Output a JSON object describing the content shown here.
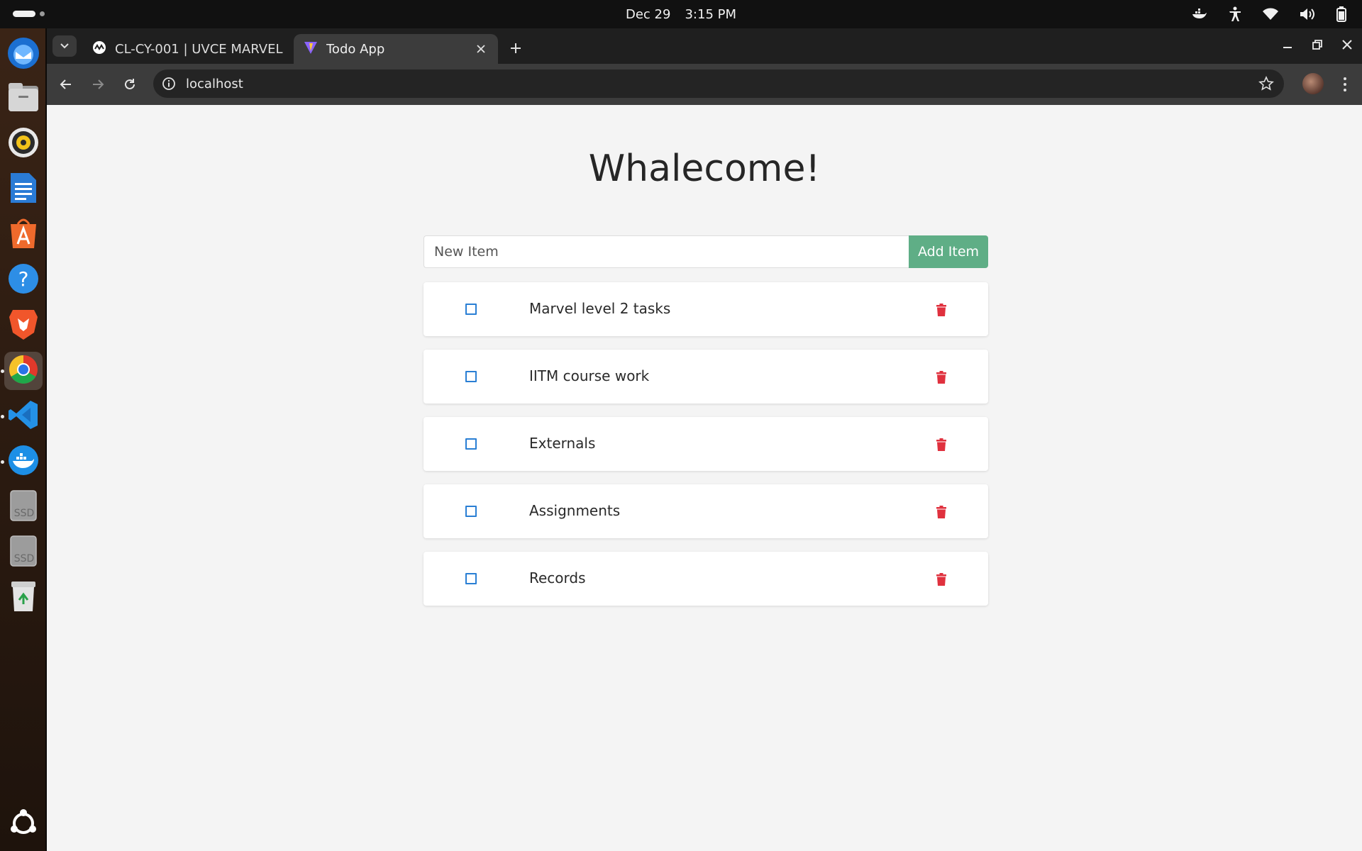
{
  "system_bar": {
    "date": "Dec 29",
    "time": "3:15 PM",
    "tray_icons": [
      "docker-icon",
      "accessibility-icon",
      "wifi-icon",
      "volume-icon",
      "battery-icon"
    ]
  },
  "dock": {
    "apps": [
      {
        "name": "Thunderbird",
        "icon": "thunderbird-icon"
      },
      {
        "name": "Files",
        "icon": "files-icon"
      },
      {
        "name": "Rhythmbox",
        "icon": "rhythmbox-icon"
      },
      {
        "name": "LibreOffice Writer",
        "icon": "writer-icon"
      },
      {
        "name": "App Center",
        "icon": "app-center-icon"
      },
      {
        "name": "Help",
        "icon": "help-icon"
      },
      {
        "name": "Brave",
        "icon": "brave-icon"
      },
      {
        "name": "Chrome",
        "icon": "chrome-icon"
      },
      {
        "name": "VS Code",
        "icon": "vscode-icon"
      },
      {
        "name": "Docker",
        "icon": "docker-icon"
      },
      {
        "name": "SSD",
        "icon": "ssd-icon"
      },
      {
        "name": "SSD",
        "icon": "ssd-icon"
      },
      {
        "name": "Trash",
        "icon": "trash-icon"
      },
      {
        "name": "Show Apps",
        "icon": "ubuntu-icon"
      }
    ],
    "ssd_label": "SSD"
  },
  "browser": {
    "tabs": [
      {
        "title": "CL-CY-001 | UVCE MARVEL",
        "active": false
      },
      {
        "title": "Todo App",
        "active": true
      }
    ],
    "url": "localhost"
  },
  "app": {
    "heading": "Whalecome!",
    "input_placeholder": "New Item",
    "add_button_label": "Add Item",
    "items": [
      {
        "text": "Marvel level 2 tasks",
        "done": false
      },
      {
        "text": "IITM course work",
        "done": false
      },
      {
        "text": "Externals",
        "done": false
      },
      {
        "text": "Assignments",
        "done": false
      },
      {
        "text": "Records",
        "done": false
      }
    ]
  },
  "colors": {
    "accent_green": "#5fae86",
    "checkbox_blue": "#2a7fd4",
    "delete_red": "#e0313e",
    "page_bg": "#f4f4f4"
  }
}
